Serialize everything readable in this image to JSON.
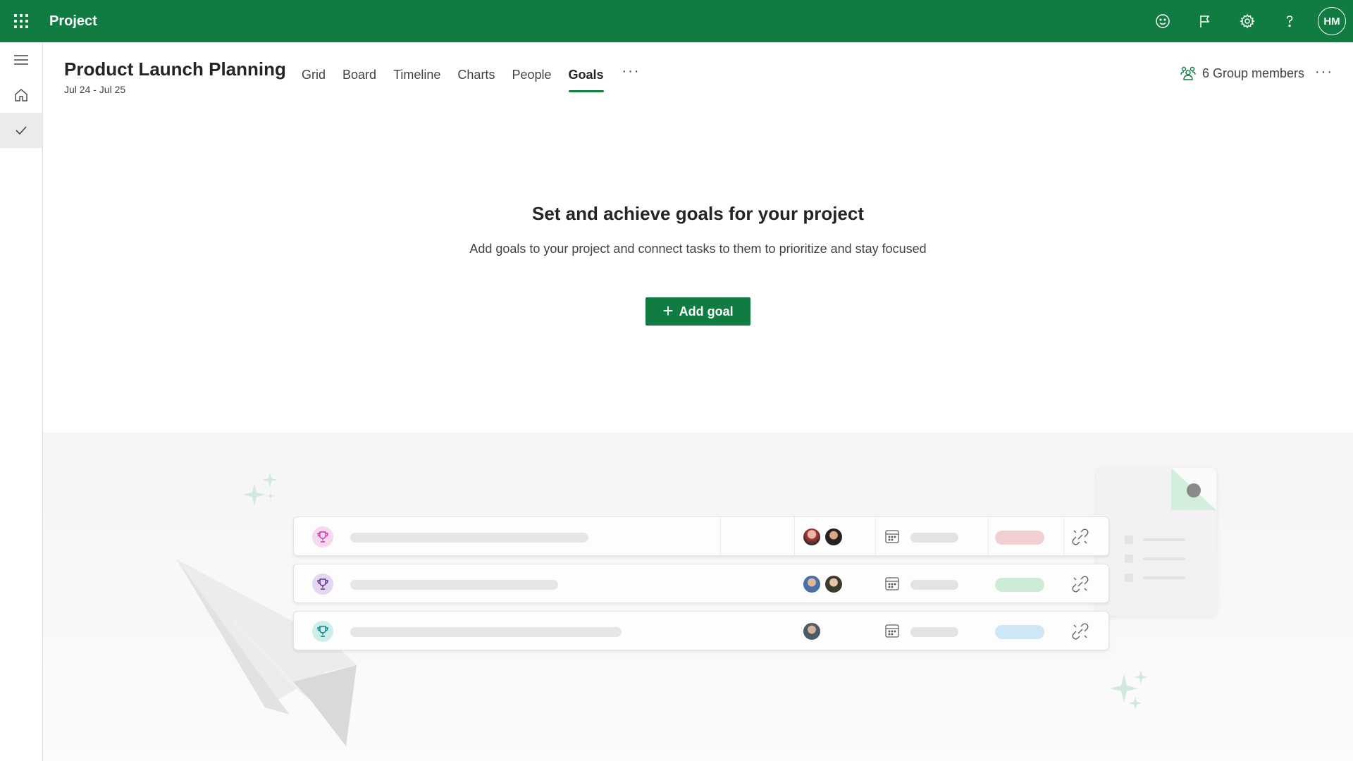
{
  "app": {
    "name": "Project"
  },
  "topbar": {
    "user_initials": "HM"
  },
  "project": {
    "title": "Product Launch Planning",
    "dates": "Jul 24 - Jul 25"
  },
  "tabs": [
    {
      "label": "Grid"
    },
    {
      "label": "Board"
    },
    {
      "label": "Timeline"
    },
    {
      "label": "Charts"
    },
    {
      "label": "People"
    },
    {
      "label": "Goals",
      "active": true
    }
  ],
  "tabs_more": "···",
  "group": {
    "members_label": "6 Group members",
    "more": "···"
  },
  "empty_state": {
    "title": "Set and achieve goals for your project",
    "description": "Add goals to your project and connect tasks to them to prioritize and stay focused",
    "button_label": "Add goal",
    "button_icon": "+"
  },
  "colors": {
    "brand": "#107c41",
    "trophy_pink": "#f7d9ee",
    "trophy_purple": "#e2d6f0",
    "trophy_teal": "#cdeee8",
    "pill_red": "#f2cfd3",
    "pill_green": "#cdebd7",
    "pill_blue": "#cfe6f7"
  }
}
